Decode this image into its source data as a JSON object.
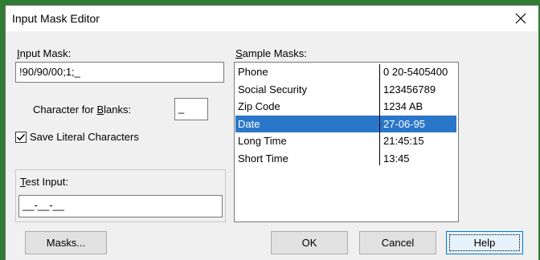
{
  "window": {
    "title": "Input Mask Editor",
    "close_glyph": "✕"
  },
  "input_mask": {
    "label_pre": "",
    "label_underlined": "I",
    "label_post": "nput Mask:",
    "value": "!90/90/00;1;_"
  },
  "char_for_blanks": {
    "label_pre": "Character for ",
    "label_underlined": "B",
    "label_post": "lanks:",
    "value": "_"
  },
  "save_literal": {
    "label": "Save Literal Characters",
    "checked": true
  },
  "test_input": {
    "label_pre": "",
    "label_underlined": "T",
    "label_post": "est Input:",
    "value": "__-__-__"
  },
  "sample_masks": {
    "label_pre": "",
    "label_underlined": "S",
    "label_post": "ample Masks:",
    "rows": [
      {
        "name": "Phone",
        "value": "0  20-5405400"
      },
      {
        "name": "Social Security",
        "value": "123456789"
      },
      {
        "name": "Zip Code",
        "value": "1234 AB"
      },
      {
        "name": "Date",
        "value": "27-06-95"
      },
      {
        "name": "Long Time",
        "value": "21:45:15"
      },
      {
        "name": "Short Time",
        "value": "13:45"
      }
    ],
    "selected_index": 3
  },
  "buttons": {
    "masks": "Masks...",
    "ok": "OK",
    "cancel": "Cancel",
    "help": "Help"
  },
  "colors": {
    "background": "#2f7d32",
    "selection": "#2a77c9",
    "default_button_border": "#0078d7"
  }
}
